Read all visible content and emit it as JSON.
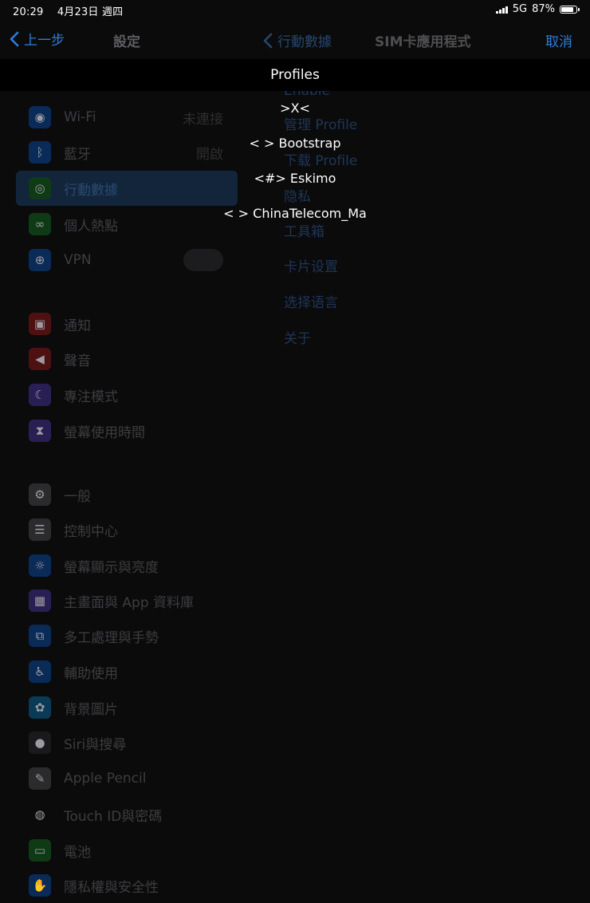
{
  "status_bar": {
    "time": "20:29",
    "date": "4月23日 週四",
    "network": "5G",
    "battery_percent": "87%",
    "battery_level": 0.87
  },
  "nav": {
    "back_label": "上一步",
    "settings_title": "設定",
    "detail_back_label": "行動數據",
    "detail_title": "SIM卡應用程式",
    "cancel_label": "取消"
  },
  "sidebar": {
    "items": [
      {
        "icon": "wifi-icon",
        "label": "Wi-Fi",
        "value": "未連接",
        "color": "#0a2a57"
      },
      {
        "icon": "bluetooth-icon",
        "label": "藍牙",
        "value": "開啟",
        "color": "#0a2a57"
      },
      {
        "icon": "cellular-icon",
        "label": "行動數據",
        "value": "",
        "color": "#0f3a16"
      },
      {
        "icon": "hotspot-icon",
        "label": "個人熱點",
        "value": "",
        "color": "#0f3a16"
      },
      {
        "icon": "vpn-icon",
        "label": "VPN",
        "value": "",
        "color": "#0a2a57"
      },
      {
        "icon": "notifications-icon",
        "label": "通知",
        "value": "",
        "color": "#4d1111"
      },
      {
        "icon": "sounds-icon",
        "label": "聲音",
        "value": "",
        "color": "#4d1111"
      },
      {
        "icon": "focus-icon",
        "label": "專注模式",
        "value": "",
        "color": "#2a1f55"
      },
      {
        "icon": "screen-time-icon",
        "label": "螢幕使用時間",
        "value": "",
        "color": "#2a1f55"
      },
      {
        "icon": "general-icon",
        "label": "一般",
        "value": "",
        "color": "#2b2b2d"
      },
      {
        "icon": "control-center-icon",
        "label": "控制中心",
        "value": "",
        "color": "#2b2b2d"
      },
      {
        "icon": "display-icon",
        "label": "螢幕顯示與亮度",
        "value": "",
        "color": "#0a2a57"
      },
      {
        "icon": "home-screen-icon",
        "label": "主畫面與 App 資料庫",
        "value": "",
        "color": "#2a1f55"
      },
      {
        "icon": "multitasking-icon",
        "label": "多工處理與手勢",
        "value": "",
        "color": "#0a2a57"
      },
      {
        "icon": "accessibility-icon",
        "label": "輔助使用",
        "value": "",
        "color": "#0a2a57"
      },
      {
        "icon": "wallpaper-icon",
        "label": "背景圖片",
        "value": "",
        "color": "#0a3a55"
      },
      {
        "icon": "siri-icon",
        "label": "Siri與搜尋",
        "value": "",
        "color": "#1a1a1c"
      },
      {
        "icon": "pencil-icon",
        "label": "Apple Pencil",
        "value": "",
        "color": "#2b2b2d"
      },
      {
        "icon": "touch-id-icon",
        "label": "Touch ID與密碼",
        "value": "",
        "color": "#0b0b0c"
      },
      {
        "icon": "battery-icon",
        "label": "電池",
        "value": "",
        "color": "#0f3a16"
      },
      {
        "icon": "privacy-icon",
        "label": "隱私權與安全性",
        "value": "",
        "color": "#0a2a57"
      }
    ]
  },
  "detail": {
    "items": [
      "Enable",
      "管理 Profile",
      "下载 Profile",
      "隐私",
      "工具箱",
      "卡片设置",
      "选择语言",
      "关于"
    ]
  },
  "popover": {
    "title": "Profiles",
    "options": [
      ">X<",
      "< > Bootstrap",
      "<#> Eskimo",
      "< > ChinaTelecom_Ma"
    ]
  }
}
